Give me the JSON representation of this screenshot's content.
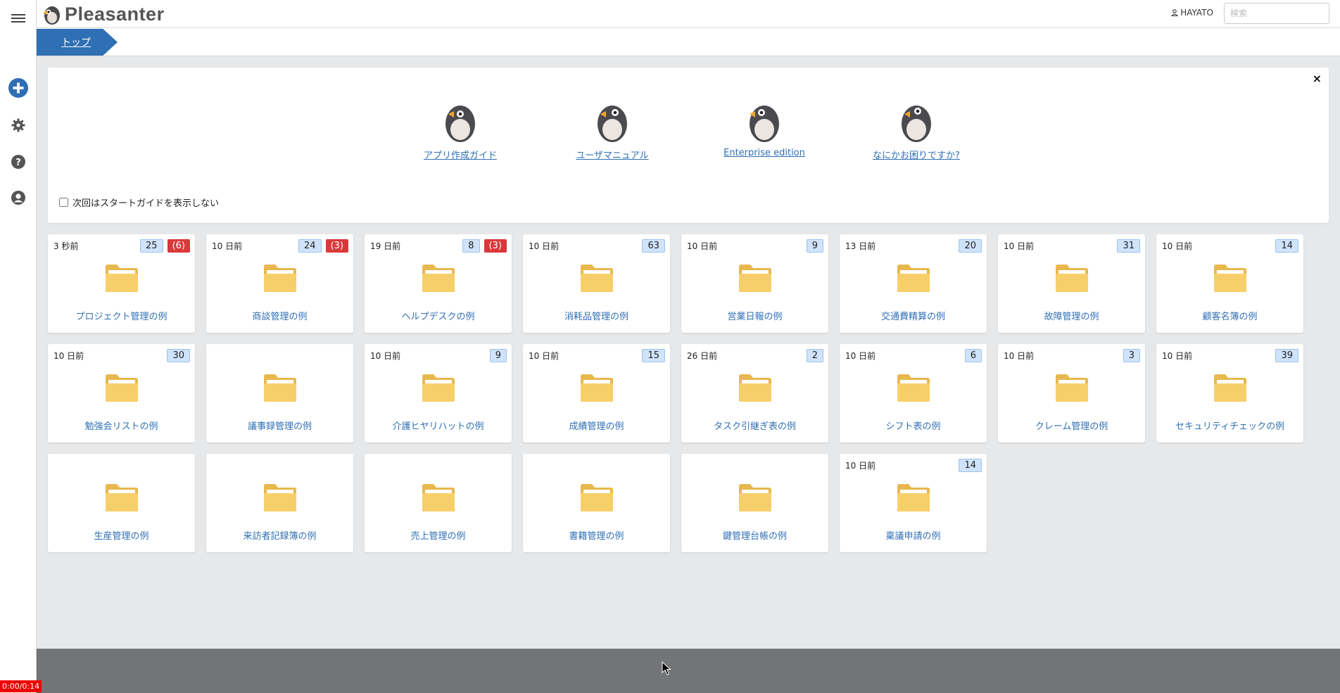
{
  "app": {
    "logo_text": "Pleasanter"
  },
  "header": {
    "user_name": "HAYATO",
    "search_placeholder": "検索"
  },
  "breadcrumb": {
    "top": "トップ"
  },
  "sidebar": {
    "icons": [
      "menu-icon",
      "plus-icon",
      "gear-icon",
      "help-icon",
      "user-icon"
    ]
  },
  "guide": {
    "links": [
      {
        "label": "アプリ作成ガイド"
      },
      {
        "label": "ユーザマニュアル"
      },
      {
        "label": "Enterprise edition"
      },
      {
        "label": "なにかお困りですか?"
      }
    ],
    "checkbox_label": "次回はスタートガイドを表示しない",
    "close_glyph": "×"
  },
  "sites": [
    {
      "time": "3 秒前",
      "count": "25",
      "alert": "(6)",
      "title": "プロジェクト管理の例"
    },
    {
      "time": "10 日前",
      "count": "24",
      "alert": "(3)",
      "title": "商談管理の例"
    },
    {
      "time": "19 日前",
      "count": "8",
      "alert": "(3)",
      "title": "ヘルプデスクの例"
    },
    {
      "time": "10 日前",
      "count": "63",
      "alert": "",
      "title": "消耗品管理の例"
    },
    {
      "time": "10 日前",
      "count": "9",
      "alert": "",
      "title": "営業日報の例"
    },
    {
      "time": "13 日前",
      "count": "20",
      "alert": "",
      "title": "交通費精算の例"
    },
    {
      "time": "10 日前",
      "count": "31",
      "alert": "",
      "title": "故障管理の例"
    },
    {
      "time": "10 日前",
      "count": "14",
      "alert": "",
      "title": "顧客名簿の例"
    },
    {
      "time": "10 日前",
      "count": "30",
      "alert": "",
      "title": "勉強会リストの例"
    },
    {
      "time": "",
      "count": "",
      "alert": "",
      "title": "議事録管理の例"
    },
    {
      "time": "10 日前",
      "count": "9",
      "alert": "",
      "title": "介護ヒヤリハットの例"
    },
    {
      "time": "10 日前",
      "count": "15",
      "alert": "",
      "title": "成績管理の例"
    },
    {
      "time": "26 日前",
      "count": "2",
      "alert": "",
      "title": "タスク引継ぎ表の例"
    },
    {
      "time": "10 日前",
      "count": "6",
      "alert": "",
      "title": "シフト表の例"
    },
    {
      "time": "10 日前",
      "count": "3",
      "alert": "",
      "title": "クレーム管理の例"
    },
    {
      "time": "10 日前",
      "count": "39",
      "alert": "",
      "title": "セキュリティチェックの例"
    },
    {
      "time": "",
      "count": "",
      "alert": "",
      "title": "生産管理の例"
    },
    {
      "time": "",
      "count": "",
      "alert": "",
      "title": "来訪者記録簿の例"
    },
    {
      "time": "",
      "count": "",
      "alert": "",
      "title": "売上管理の例"
    },
    {
      "time": "",
      "count": "",
      "alert": "",
      "title": "書籍管理の例"
    },
    {
      "time": "",
      "count": "",
      "alert": "",
      "title": "鍵管理台帳の例"
    },
    {
      "time": "10 日前",
      "count": "14",
      "alert": "",
      "title": "稟議申請の例"
    }
  ],
  "footer": {
    "timer": "0:00/0:14"
  },
  "colors": {
    "accent": "#2f6fb4",
    "alert": "#d9393b",
    "badge": "#cfe3fb",
    "folder": "#f7cf6a",
    "footer": "#737476"
  }
}
